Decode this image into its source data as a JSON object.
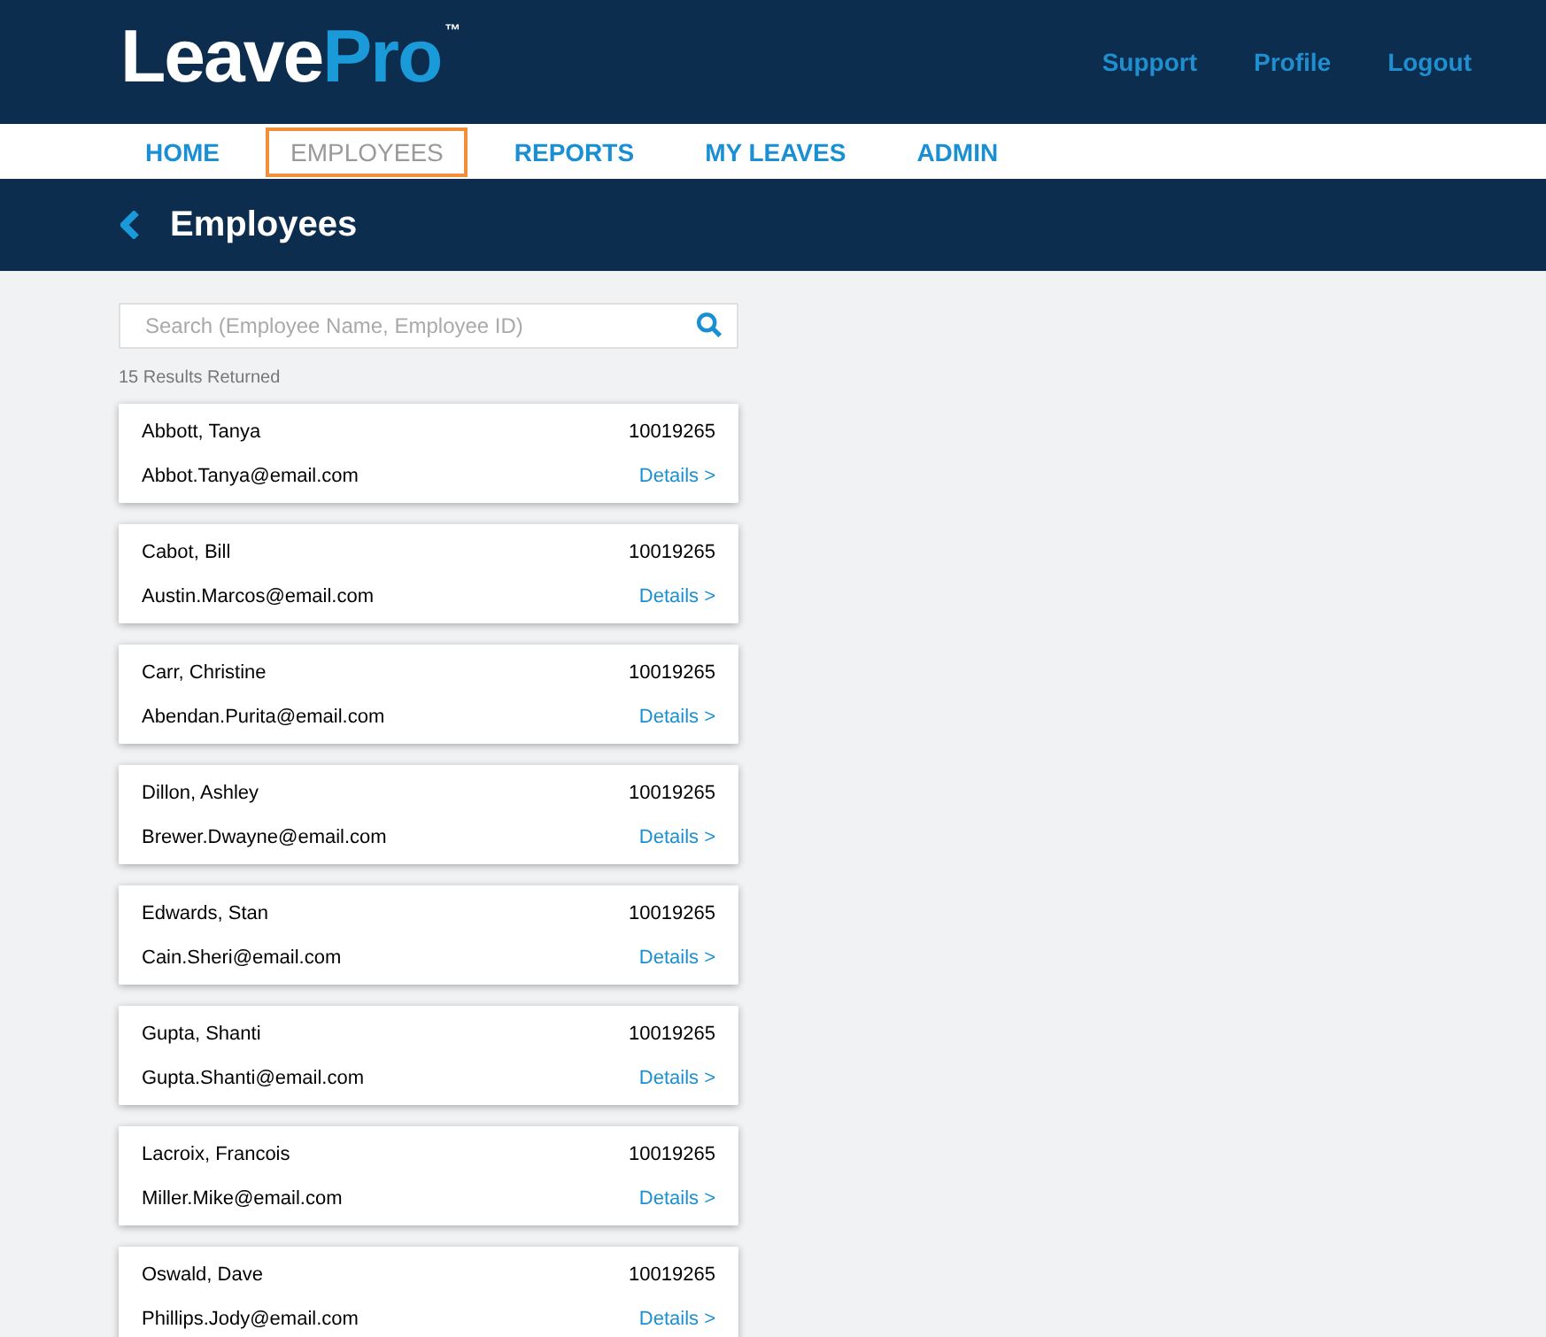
{
  "header": {
    "logo": {
      "text": "Leave",
      "accent": "Pro",
      "mark": "™"
    },
    "links": [
      "Support",
      "Profile",
      "Logout"
    ]
  },
  "nav": [
    {
      "label": "HOME",
      "selected": false
    },
    {
      "label": "EMPLOYEES",
      "selected": true
    },
    {
      "label": "REPORTS",
      "selected": false
    },
    {
      "label": "MY LEAVES",
      "selected": false
    },
    {
      "label": "ADMIN",
      "selected": false
    }
  ],
  "page_title": "Employees",
  "search": {
    "placeholder": "Search (Employee Name, Employee ID)"
  },
  "results_count": "15 Results Returned",
  "employees": [
    {
      "name": "Abbott, Tanya",
      "id": "10019265",
      "email": "Abbot.Tanya@email.com",
      "link": "Details >"
    },
    {
      "name": "Cabot, Bill",
      "id": "10019265",
      "email": "Austin.Marcos@email.com",
      "link": "Details >"
    },
    {
      "name": "Carr, Christine",
      "id": "10019265",
      "email": "Abendan.Purita@email.com",
      "link": "Details >"
    },
    {
      "name": "Dillon, Ashley",
      "id": "10019265",
      "email": "Brewer.Dwayne@email.com",
      "link": "Details >"
    },
    {
      "name": "Edwards, Stan",
      "id": "10019265",
      "email": "Cain.Sheri@email.com",
      "link": "Details >"
    },
    {
      "name": "Gupta, Shanti",
      "id": "10019265",
      "email": "Gupta.Shanti@email.com",
      "link": "Details >"
    },
    {
      "name": "Lacroix, Francois",
      "id": "10019265",
      "email": "Miller.Mike@email.com",
      "link": "Details >"
    },
    {
      "name": "Oswald, Dave",
      "id": "10019265",
      "email": "Phillips.Jody@email.com",
      "link": "Details >"
    }
  ]
}
